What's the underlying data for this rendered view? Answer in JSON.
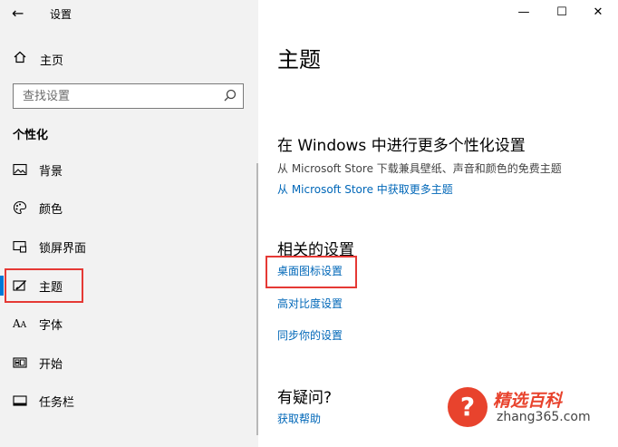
{
  "window": {
    "title": "设置",
    "back": "←",
    "minimize": "—",
    "maximize": "☐",
    "close": "✕"
  },
  "sidebar": {
    "home_label": "主页",
    "search_placeholder": "查找设置",
    "section_label": "个性化",
    "items": [
      {
        "label": "背景",
        "icon": "image-icon"
      },
      {
        "label": "颜色",
        "icon": "palette-icon"
      },
      {
        "label": "锁屏界面",
        "icon": "lock-screen-icon"
      },
      {
        "label": "主题",
        "icon": "theme-icon",
        "active": true
      },
      {
        "label": "字体",
        "icon": "font-icon"
      },
      {
        "label": "开始",
        "icon": "start-icon"
      },
      {
        "label": "任务栏",
        "icon": "taskbar-icon"
      }
    ]
  },
  "main": {
    "title": "主题",
    "more_heading": "在 Windows 中进行更多个性化设置",
    "more_desc": "从 Microsoft Store 下载兼具壁纸、声音和颜色的免费主题",
    "more_link": "从 Microsoft Store 中获取更多主题",
    "related_heading": "相关的设置",
    "related_links": [
      "桌面图标设置",
      "高对比度设置",
      "同步你的设置"
    ],
    "question_heading": "有疑问?",
    "help_link": "获取帮助"
  },
  "watermark": {
    "symbol": "?",
    "title": "精选百科",
    "site": "zhang365.com"
  },
  "colors": {
    "accent": "#0078d7",
    "link": "#0067b8",
    "highlight_box": "#e53935",
    "sidebar_bg": "#f2f2f2"
  }
}
